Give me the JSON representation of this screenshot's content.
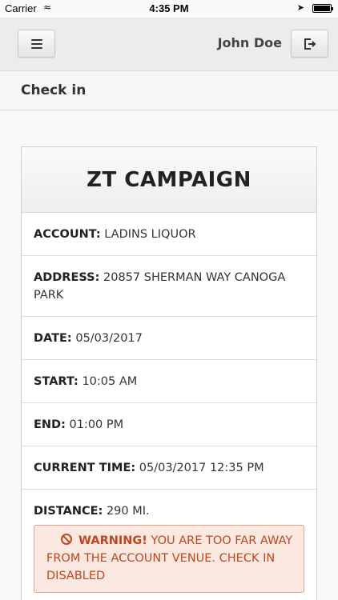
{
  "status_bar": {
    "carrier": "Carrier",
    "time": "4:35 PM"
  },
  "nav": {
    "user_name": "John Doe"
  },
  "page": {
    "title": "Check in"
  },
  "card": {
    "title": "ZT CAMPAIGN",
    "rows": [
      {
        "label": "ACCOUNT:",
        "value": "LADINS LIQUOR"
      },
      {
        "label": "ADDRESS:",
        "value": "20857 SHERMAN WAY CANOGA PARK"
      },
      {
        "label": "DATE:",
        "value": "05/03/2017"
      },
      {
        "label": "START:",
        "value": "10:05 AM"
      },
      {
        "label": "END:",
        "value": "01:00 PM"
      },
      {
        "label": "CURRENT TIME:",
        "value": "05/03/2017 12:35 PM"
      },
      {
        "label": "DISTANCE:",
        "value": "290 MI."
      }
    ],
    "warning": {
      "title": "WARNING!",
      "message": "YOU ARE TOO FAR AWAY FROM THE ACCOUNT VENUE. CHECK IN DISABLED"
    }
  }
}
